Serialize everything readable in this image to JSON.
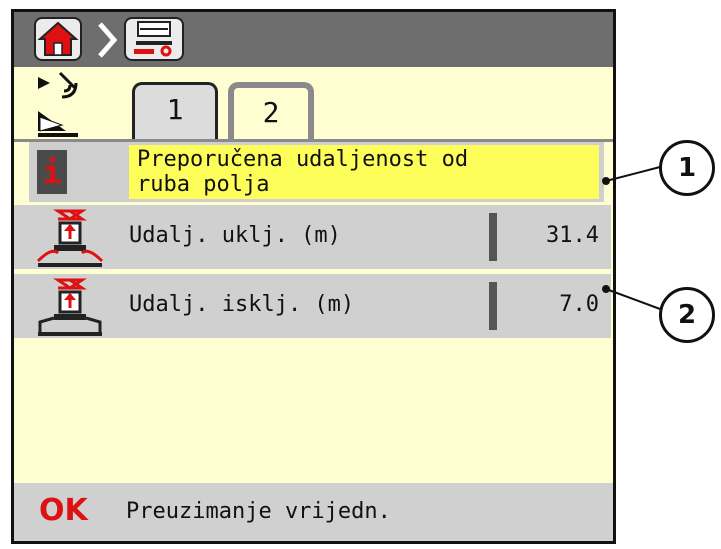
{
  "tabs": [
    {
      "label": "1"
    },
    {
      "label": "2"
    }
  ],
  "info": {
    "icon": "i",
    "text_line1": "Preporučena udaljenost od",
    "text_line2": "ruba polja"
  },
  "params": [
    {
      "label": "Udalj. uklj. (m)",
      "value": "31.4"
    },
    {
      "label": "Udalj. isklj. (m)",
      "value": "7.0"
    }
  ],
  "footer": {
    "ok": "OK",
    "text": "Preuzimanje vrijedn."
  },
  "callouts": [
    {
      "label": "1"
    },
    {
      "label": "2"
    }
  ],
  "colors": {
    "background": "#fefed2",
    "highlight": "#fefe5a",
    "row": "#d0d0d0",
    "accent_red": "#d11111",
    "topbar": "#6e6e6e"
  },
  "icons": [
    "home-icon",
    "breadcrumb-chevron-icon",
    "spreader-settings-icon",
    "gps-signal-icon",
    "boundary-spread-icon",
    "spreader-on-icon",
    "spreader-off-icon"
  ]
}
